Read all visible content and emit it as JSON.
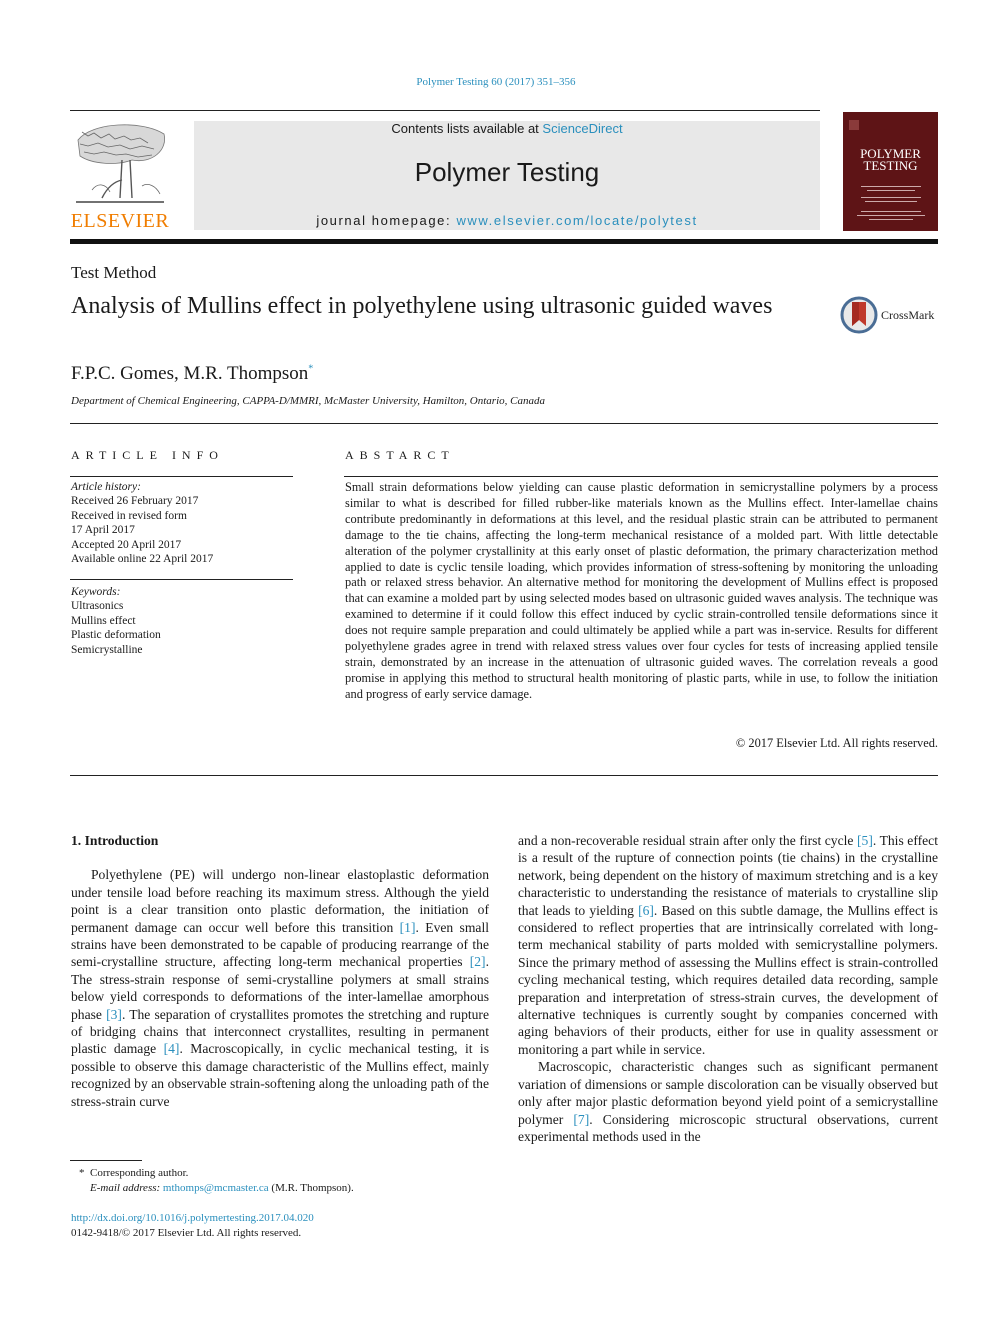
{
  "header": {
    "citation": "Polymer Testing 60 (2017) 351–356",
    "contents_prefix": "Contents lists available at ",
    "contents_link": "ScienceDirect",
    "journal_title": "Polymer Testing",
    "homepage_prefix": "journal homepage: ",
    "homepage_link": "www.elsevier.com/locate/polytest",
    "publisher_logo_text": "ELSEVIER",
    "cover_title_line1": "POLYMER",
    "cover_title_line2": "TESTING",
    "colors": {
      "link": "#2a8fbd",
      "publisher": "#f07d00",
      "cover": "#5e1416"
    }
  },
  "article": {
    "type": "Test Method",
    "title": "Analysis of Mullins effect in polyethylene using ultrasonic guided waves",
    "crossmark_label": "CrossMark",
    "authors": "F.P.C. Gomes, M.R. Thompson",
    "author_mark": "*",
    "affiliation": "Department of Chemical Engineering, CAPPA-D/MMRI, McMaster University, Hamilton, Ontario, Canada"
  },
  "article_info": {
    "heading": "ARTICLE INFO",
    "history_label": "Article history:",
    "history": [
      "Received 26 February 2017",
      "Received in revised form",
      "17 April 2017",
      "Accepted 20 April 2017",
      "Available online 22 April 2017"
    ],
    "keywords_label": "Keywords:",
    "keywords": [
      "Ultrasonics",
      "Mullins effect",
      "Plastic deformation",
      "Semicrystalline"
    ]
  },
  "abstract": {
    "heading": "ABSTARCT",
    "text": "Small strain deformations below yielding can cause plastic deformation in semicrystalline polymers by a process similar to what is described for filled rubber-like materials known as the Mullins effect. Inter-lamellae chains contribute predominantly in deformations at this level, and the residual plastic strain can be attributed to permanent damage to the tie chains, affecting the long-term mechanical resistance of a molded part. With little detectable alteration of the polymer crystallinity at this early onset of plastic deformation, the primary characterization method applied to date is cyclic tensile loading, which provides information of stress-softening by monitoring the unloading path or relaxed stress behavior. An alternative method for monitoring the development of Mullins effect is proposed that can examine a molded part by using selected modes based on ultrasonic guided waves analysis. The technique was examined to determine if it could follow this effect induced by cyclic strain-controlled tensile deformations since it does not require sample preparation and could ultimately be applied while a part was in-service. Results for different polyethylene grades agree in trend with relaxed stress values over four cycles for tests of increasing applied tensile strain, demonstrated by an increase in the attenuation of ultrasonic guided waves. The correlation reveals a good promise in applying this method to structural health monitoring of plastic parts, while in use, to follow the initiation and progress of early service damage.",
    "copyright": "© 2017 Elsevier Ltd. All rights reserved."
  },
  "body": {
    "section_heading": "1.  Introduction",
    "left_p1": [
      "Polyethylene (PE) will undergo non-linear elastoplastic deformation under tensile load before reaching its maximum stress. Although the yield point is a clear transition onto plastic deformation, the initiation of permanent damage can occur well before this transition ",
      "[1]",
      ". Even small strains have been demonstrated to be capable of producing rearrange of the semi-crystalline structure, affecting long-term mechanical properties ",
      "[2]",
      ". The stress-strain response of semi-crystalline polymers at small strains below yield corresponds to deformations of the inter-lamellae amorphous phase ",
      "[3]",
      ". The separation of crystallites promotes the stretching and rupture of bridging chains that interconnect crystallites, resulting in permanent plastic damage ",
      "[4]",
      ". Macroscopically, in cyclic mechanical testing, it is possible to observe this damage characteristic of the Mullins effect, mainly recognized by an observable strain-softening along the unloading path of the stress-strain curve"
    ],
    "right_p1": [
      "and a non-recoverable residual strain after only the first cycle ",
      "[5]",
      ". This effect is a result of the rupture of connection points (tie chains) in the crystalline network, being dependent on the history of maximum stretching and is a key characteristic to understanding the resistance of materials to crystalline slip that leads to yielding ",
      "[6]",
      ". Based on this subtle damage, the Mullins effect is considered to reflect properties that are intrinsically correlated with long-term mechanical stability of parts molded with semicrystalline polymers. Since the primary method of assessing the Mullins effect is strain-controlled cycling mechanical testing, which requires detailed data recording, sample preparation and interpretation of stress-strain curves, the development of alternative techniques is currently sought by companies concerned with aging behaviors of their products, either for use in quality assessment or monitoring a part while in service."
    ],
    "right_p2": [
      "Macroscopic, characteristic changes such as significant permanent variation of dimensions or sample discoloration can be visually observed but only after major plastic deformation beyond yield point of a semicrystalline polymer ",
      "[7]",
      ". Considering microscopic structural observations, current experimental methods used in the"
    ]
  },
  "footnote": {
    "mark": "*",
    "corresponding": "Corresponding author.",
    "email_label": "E-mail address: ",
    "email": "mthomps@mcmaster.ca",
    "email_suffix": " (M.R. Thompson).",
    "doi": "http://dx.doi.org/10.1016/j.polymertesting.2017.04.020",
    "issn_line": "0142-9418/© 2017 Elsevier Ltd. All rights reserved."
  }
}
